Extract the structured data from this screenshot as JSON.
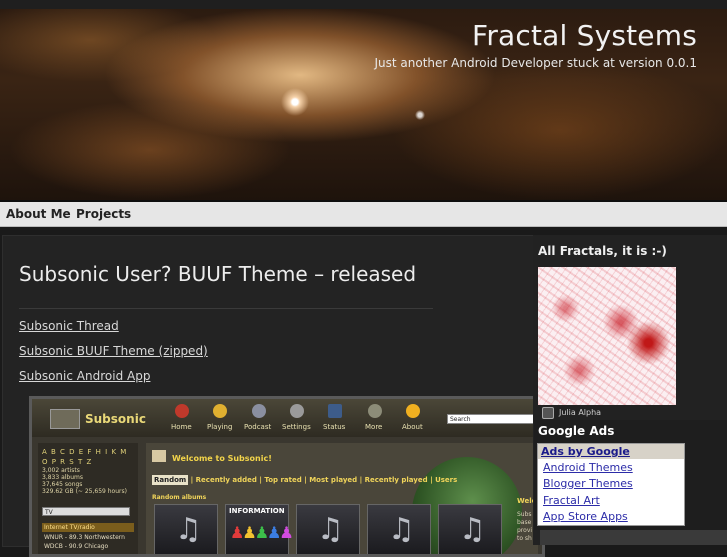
{
  "header": {
    "site_title": "Fractal Systems",
    "tagline": "Just another Android Developer stuck at version 0.0.1"
  },
  "nav": {
    "items": [
      {
        "label": "About Me"
      },
      {
        "label": "Projects"
      }
    ]
  },
  "post": {
    "title": "Subsonic User? BUUF Theme – released",
    "links": [
      {
        "label": "Subsonic Thread"
      },
      {
        "label": "Subsonic BUUF Theme (zipped)"
      },
      {
        "label": "Subsonic Android App"
      }
    ]
  },
  "screenshot": {
    "logo": "Subsonic",
    "tabs": [
      "Home",
      "Playing",
      "Podcast",
      "Settings",
      "Status",
      "More",
      "About"
    ],
    "search_value": "Search",
    "letters": "A B C D E F H I K M O P R S T Z",
    "stats": [
      "3,002 artists",
      "3,833 albums",
      "37,645 songs",
      "329.62 GB (~ 25,659 hours)"
    ],
    "select_value": "TV",
    "radio_header": "Internet TV/radio",
    "radio_items": [
      "WNUR - 89.3 Northwestern",
      "WDCB - 90.9 Chicago"
    ],
    "welcome": "Welcome to Subsonic!",
    "link_bar": [
      "Random",
      "Recently added",
      "Top rated",
      "Most played",
      "Recently played",
      "Users"
    ],
    "random_albums": "Random albums",
    "info_label": "INFORMATION",
    "right_title": "Welc",
    "right_text": [
      "Subs",
      "base",
      "provi",
      "to sh"
    ]
  },
  "sidebar": {
    "widget_title": "All Fractals, it is :-)",
    "fractal_caption": "Julia Alpha"
  },
  "ads": {
    "title": "Google Ads",
    "by": "Ads by Google",
    "links": [
      {
        "label": "Android Themes"
      },
      {
        "label": "Blogger Themes"
      },
      {
        "label": "Fractal Art"
      },
      {
        "label": "App Store Apps"
      }
    ]
  },
  "colors": {
    "accent_gold": "#f0d45a",
    "link_blue": "#2c2ca8",
    "nav_bg": "#e6e6e6"
  }
}
